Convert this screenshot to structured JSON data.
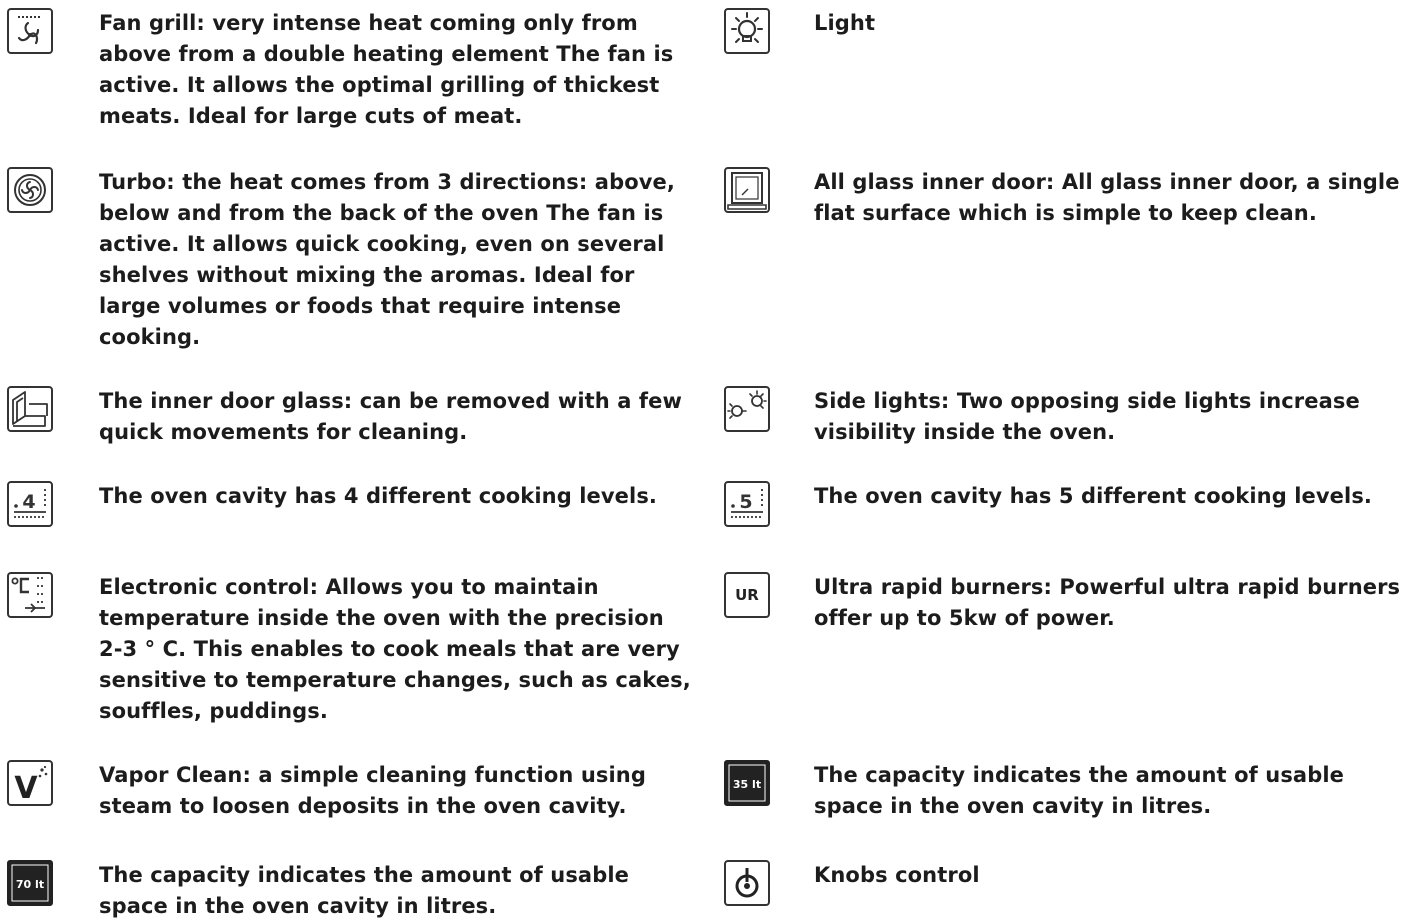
{
  "colors": {
    "text": "#1c1c1c",
    "icon_stroke": "#333333",
    "icon_dark": "#222222"
  },
  "left_items": [
    {
      "icon": "fan-grill-icon",
      "text": "Fan grill: very intense heat coming only from above from a double heating element The fan is active. It allows the optimal grilling of thickest meats. Ideal for large cuts of meat."
    },
    {
      "icon": "turbo-fan-icon",
      "text": "Turbo: the heat comes from 3 directions: above, below and from the back of the oven The fan is active. It allows quick cooking, even on several shelves without mixing the aromas. Ideal for large volumes or foods that require intense cooking."
    },
    {
      "icon": "removable-door-glass-icon",
      "text": "The inner door glass: can be removed with a few quick movements for cleaning."
    },
    {
      "icon": "four-levels-icon",
      "icon_label": "4",
      "text": "The oven cavity has 4 different cooking levels."
    },
    {
      "icon": "electronic-control-icon",
      "text": "Electronic control: Allows you to maintain temperature inside the oven with the precision 2-3 ° C. This enables to cook meals that are very sensitive to temperature changes, such as cakes, souffles, puddings."
    },
    {
      "icon": "vapor-clean-icon",
      "icon_label": "V",
      "text": "Vapor Clean: a simple cleaning function using steam to loosen deposits in the oven cavity."
    },
    {
      "icon": "capacity-70-icon",
      "icon_label": "70 lt",
      "text": "The capacity indicates the amount of usable space in the oven cavity in litres."
    }
  ],
  "right_items": [
    {
      "icon": "light-icon",
      "text": "Light"
    },
    {
      "icon": "glass-door-icon",
      "text": "All glass inner door: All glass inner door, a single flat surface which is simple to keep clean."
    },
    {
      "icon": "side-lights-icon",
      "text": "Side lights: Two opposing side lights increase visibility inside the oven."
    },
    {
      "icon": "five-levels-icon",
      "icon_label": "5",
      "text": "The oven cavity has 5 different cooking levels."
    },
    {
      "icon": "ultra-rapid-burner-icon",
      "icon_label": "UR",
      "text": "Ultra rapid burners: Powerful ultra rapid burners offer up to 5kw of power."
    },
    {
      "icon": "capacity-35-icon",
      "icon_label": "35 lt",
      "text": "The capacity indicates the amount of usable space in the oven cavity in litres."
    },
    {
      "icon": "knob-control-icon",
      "text": "Knobs control"
    }
  ]
}
